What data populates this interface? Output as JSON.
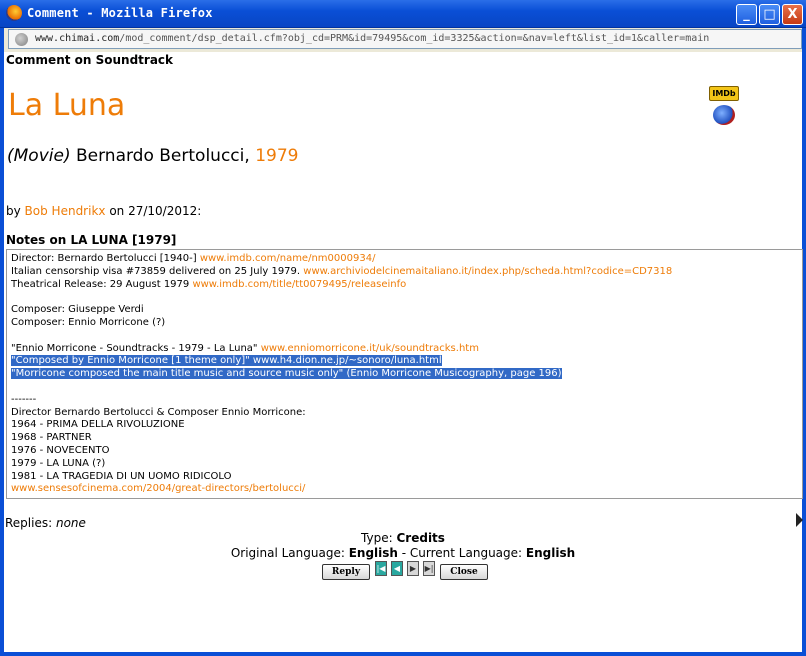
{
  "window": {
    "title": "Comment - Mozilla Firefox",
    "controls": {
      "minimize": "_",
      "maximize": "□",
      "close": "X"
    }
  },
  "urlbar": {
    "host": "www.chimai.com",
    "path": "/mod_comment/dsp_detail.cfm?obj_cd=PRM&id=79495&com_id=3325&action=&nav=left&list_id=1&caller=main"
  },
  "page": {
    "heading": "Comment on Soundtrack",
    "movie_title": "La Luna",
    "kind": "(Movie)",
    "director": "Bernardo Bertolucci,",
    "year": "1979",
    "imdb_label": "IMDb",
    "byline": {
      "prefix": "by",
      "user": "Bob Hendrikx",
      "suffix": "on 27/10/2012:"
    },
    "notes_heading": "Notes on LA LUNA [1979]",
    "notes": [
      {
        "text": "Director: Bernardo Bertolucci [1940-] ",
        "link": "www.imdb.com/name/nm0000934/"
      },
      {
        "text": "Italian censorship visa #73859 delivered on 25 July 1979. ",
        "link": "www.archiviodelcinemaitaliano.it/index.php/scheda.html?codice=CD7318"
      },
      {
        "text": "Theatrical Release: 29 August 1979 ",
        "link": "www.imdb.com/title/tt0079495/releaseinfo"
      },
      {
        "text": "",
        "link": ""
      },
      {
        "text": "Composer: Giuseppe Verdi",
        "link": ""
      },
      {
        "text": "Composer: Ennio Morricone (?)",
        "link": ""
      },
      {
        "text": "",
        "link": ""
      },
      {
        "text": "\"Ennio Morricone - Soundtracks - 1979 - La Luna\" ",
        "link": "www.enniomorricone.it/uk/soundtracks.htm"
      },
      {
        "text": "\"Composed by Ennio Morricone [1 theme only]\" www.h4.dion.ne.jp/~sonoro/luna.html",
        "link": "",
        "highlight": true
      },
      {
        "text": "\"Morricone composed the main title music and source music only\" (Ennio Morricone Musicography, page 196)",
        "link": "",
        "highlight": true
      },
      {
        "text": "",
        "link": ""
      },
      {
        "text": "-------",
        "link": ""
      },
      {
        "text": "Director Bernardo Bertolucci & Composer Ennio Morricone:",
        "link": ""
      },
      {
        "text": "1964 - PRIMA DELLA RIVOLUZIONE",
        "link": ""
      },
      {
        "text": "1968 - PARTNER",
        "link": ""
      },
      {
        "text": "1976 - NOVECENTO",
        "link": ""
      },
      {
        "text": "1979 - LA LUNA (?)",
        "link": ""
      },
      {
        "text": "1981 - LA TRAGEDIA DI UN UOMO RIDICOLO",
        "link": ""
      },
      {
        "text": "",
        "link": "www.sensesofcinema.com/2004/great-directors/bertolucci/"
      }
    ],
    "replies_label": "Replies:",
    "replies_value": "none",
    "type_label": "Type:",
    "type_value": "Credits",
    "orig_lang_label": "Original Language:",
    "orig_lang_value": "English",
    "curr_lang_label": "- Current Language:",
    "curr_lang_value": "English",
    "reply_button": "Reply",
    "close_button": "Close"
  }
}
